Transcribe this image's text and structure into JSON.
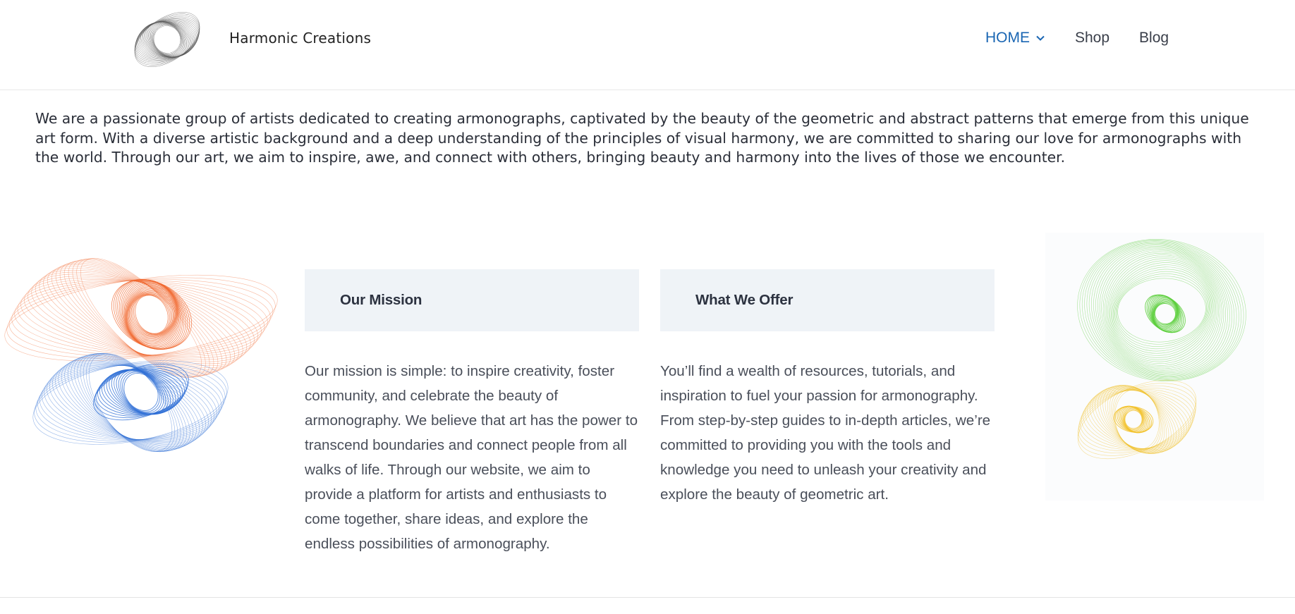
{
  "header": {
    "site_title": "Harmonic Creations",
    "logo_icon": "harmonograph-logo-icon",
    "nav": [
      {
        "label": "HOME",
        "active": true,
        "has_dropdown": true
      },
      {
        "label": "Shop",
        "active": false
      },
      {
        "label": "Blog",
        "active": false
      }
    ]
  },
  "intro": {
    "text": "We are a passionate group of artists dedicated to creating armonographs, captivated by the beauty of the geometric and abstract patterns that emerge from this unique art form. With a diverse artistic background and a deep understanding of the principles of visual harmony, we are committed to sharing our love for armonographs with the world. Through our art, we aim to inspire, awe, and connect with others, bringing beauty and harmony into the lives of those we encounter."
  },
  "columns": {
    "mission": {
      "title": "Our Mission",
      "text": "Our mission is simple: to inspire creativity, foster community, and celebrate the beauty of armonography. We believe that art has the power to transcend boundaries and connect people from all walks of life. Through our website, we aim to provide a platform for artists and enthusiasts to come together, share ideas, and explore the endless possibilities of armonography."
    },
    "offer": {
      "title": "What We Offer",
      "text": "You’ll find a wealth of resources, tutorials, and inspiration to fuel your passion for armonography. From step-by-step guides to in-depth articles, we’re committed to providing you with the tools and knowledge you need to unleash your creativity and explore the beauty of geometric art."
    }
  },
  "colors": {
    "accent": "#1a66b3",
    "box_bg": "#eff3f7",
    "art_orange": "#f0642a",
    "art_blue": "#2f6fd6",
    "art_green": "#5ccf3c",
    "art_yellow": "#f2c22a"
  },
  "icons": {
    "dropdown": "chevron-down-icon",
    "art_left": "harmonograph-orange-blue-art",
    "art_right": "harmonograph-green-yellow-art"
  }
}
